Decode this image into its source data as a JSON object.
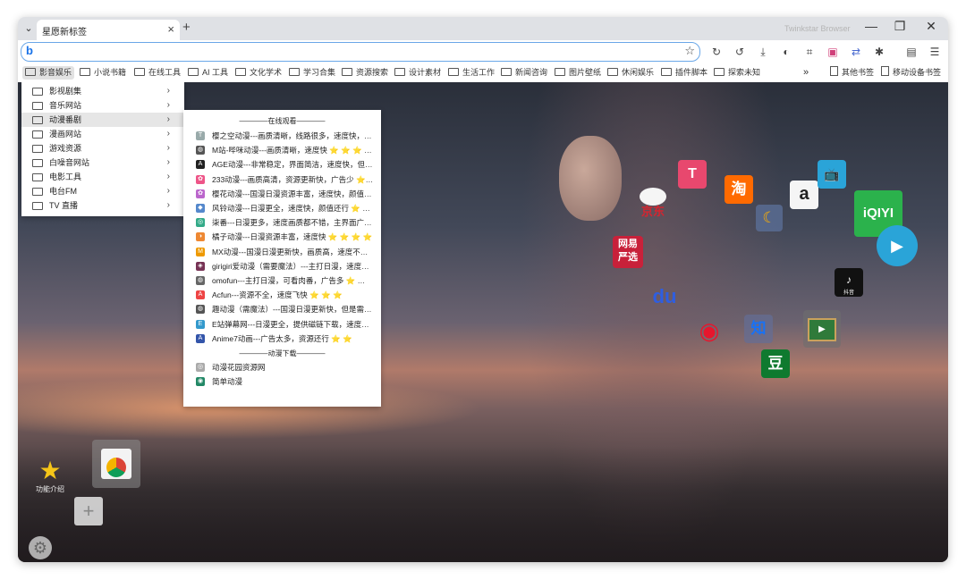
{
  "tab": {
    "title": "星愿新标签",
    "close": "×",
    "new": "+",
    "dropdown": "⌄"
  },
  "window": {
    "brand": "Twinkstar Browser",
    "min": "—",
    "restore": "❐",
    "close": "✕"
  },
  "omnibox": {
    "logo": "b",
    "value": "",
    "star": "☆"
  },
  "toolbar_icons": [
    "reload-icon",
    "history-icon",
    "download-icon",
    "theme-icon",
    "crop-icon",
    "extension-icon-1",
    "translate-icon",
    "puzzle-icon",
    "sidebar-icon",
    "menu-icon"
  ],
  "toolbar_glyphs": [
    "↻",
    "↺",
    "⤓",
    "◐",
    "⌗",
    "▣",
    "⇄",
    "✱",
    "▤",
    "☰"
  ],
  "bookmarks": {
    "items": [
      "影音娱乐",
      "小说书籍",
      "在线工具",
      "AI 工具",
      "文化学术",
      "学习合集",
      "资源搜索",
      "设计素材",
      "生活工作",
      "新闻咨询",
      "图片壁纸",
      "休闲娱乐",
      "插件脚本",
      "探索未知"
    ],
    "more": "»",
    "other": "其他书签",
    "mobile": "移动设备书签"
  },
  "menu1": {
    "items": [
      "影视剧集",
      "音乐网站",
      "动漫番剧",
      "漫画网站",
      "游戏资源",
      "白噪音网站",
      "电影工具",
      "电台FM",
      "TV 直播"
    ],
    "arrow": "›"
  },
  "menu2": {
    "sep_online": "————在线观看————",
    "items": [
      {
        "label": "樱之空动漫---画质清晰，线路很多，速度快，…",
        "icon": "T",
        "color": "#9aa"
      },
      {
        "label": "M站-哔咪动漫---画质清晰，速度快 ⭐ ⭐ ⭐ …",
        "icon": "◍",
        "color": "#555"
      },
      {
        "label": "AGE动漫---非常稳定，界面简洁，速度快，但…",
        "icon": "A",
        "color": "#222"
      },
      {
        "label": "233动漫---画质高清，资源更新快，广告少 ⭐…",
        "icon": "✿",
        "color": "#e58"
      },
      {
        "label": "樱花动漫---国漫日漫资源丰富，速度快，颜值…",
        "icon": "✿",
        "color": "#b6c"
      },
      {
        "label": "风铃动漫---日漫更全，速度快，颜值还行 ⭐ …",
        "icon": "◆",
        "color": "#58c"
      },
      {
        "label": "柒番---日漫更多，速度画质都不错，主界面广…",
        "icon": "◎",
        "color": "#3a8"
      },
      {
        "label": "橘子动漫---日漫资源丰富，速度快 ⭐ ⭐ ⭐ ⭐",
        "icon": "◑",
        "color": "#e83"
      },
      {
        "label": "MX动漫---国漫日漫更新快，画质高，速度不…",
        "icon": "M",
        "color": "#e90"
      },
      {
        "label": "girigiri爱动漫（需要魔法）---主打日漫，速度…",
        "icon": "◈",
        "color": "#735"
      },
      {
        "label": "omofun---主打日漫，可看肉番，广告多 ⭐ …",
        "icon": "◍",
        "color": "#666"
      },
      {
        "label": "Acfun---资源不全，速度飞快 ⭐ ⭐ ⭐",
        "icon": "A",
        "color": "#e44"
      },
      {
        "label": "趣动漫（需魔法）---国漫日漫更新快，但是需…",
        "icon": "◍",
        "color": "#555"
      },
      {
        "label": "E站弹幕网---日漫更全，提供磁链下载，速度…",
        "icon": "E",
        "color": "#39c"
      },
      {
        "label": "Anime7动画---广告太多，资源还行 ⭐ ⭐",
        "icon": "A",
        "color": "#35a"
      }
    ],
    "sep_download": "————动漫下载————",
    "downloads": [
      {
        "label": "动漫花园资源网",
        "icon": "◎",
        "color": "#aaa"
      },
      {
        "label": "简单动漫",
        "icon": "◉",
        "color": "#286"
      }
    ]
  },
  "desktop": {
    "jd_label": "京东",
    "taobao_label": "淘",
    "amazon_label": "a",
    "iqiyi_label": "iQIYI",
    "wangyi_label_1": "网易",
    "wangyi_label_2": "严选",
    "baidu_label": "du",
    "zhihu_label": "知",
    "douban_label": "豆",
    "tiktok_label": "抖音",
    "star_app_label": "功能介绍",
    "plus": "+",
    "gear": "⚙"
  }
}
